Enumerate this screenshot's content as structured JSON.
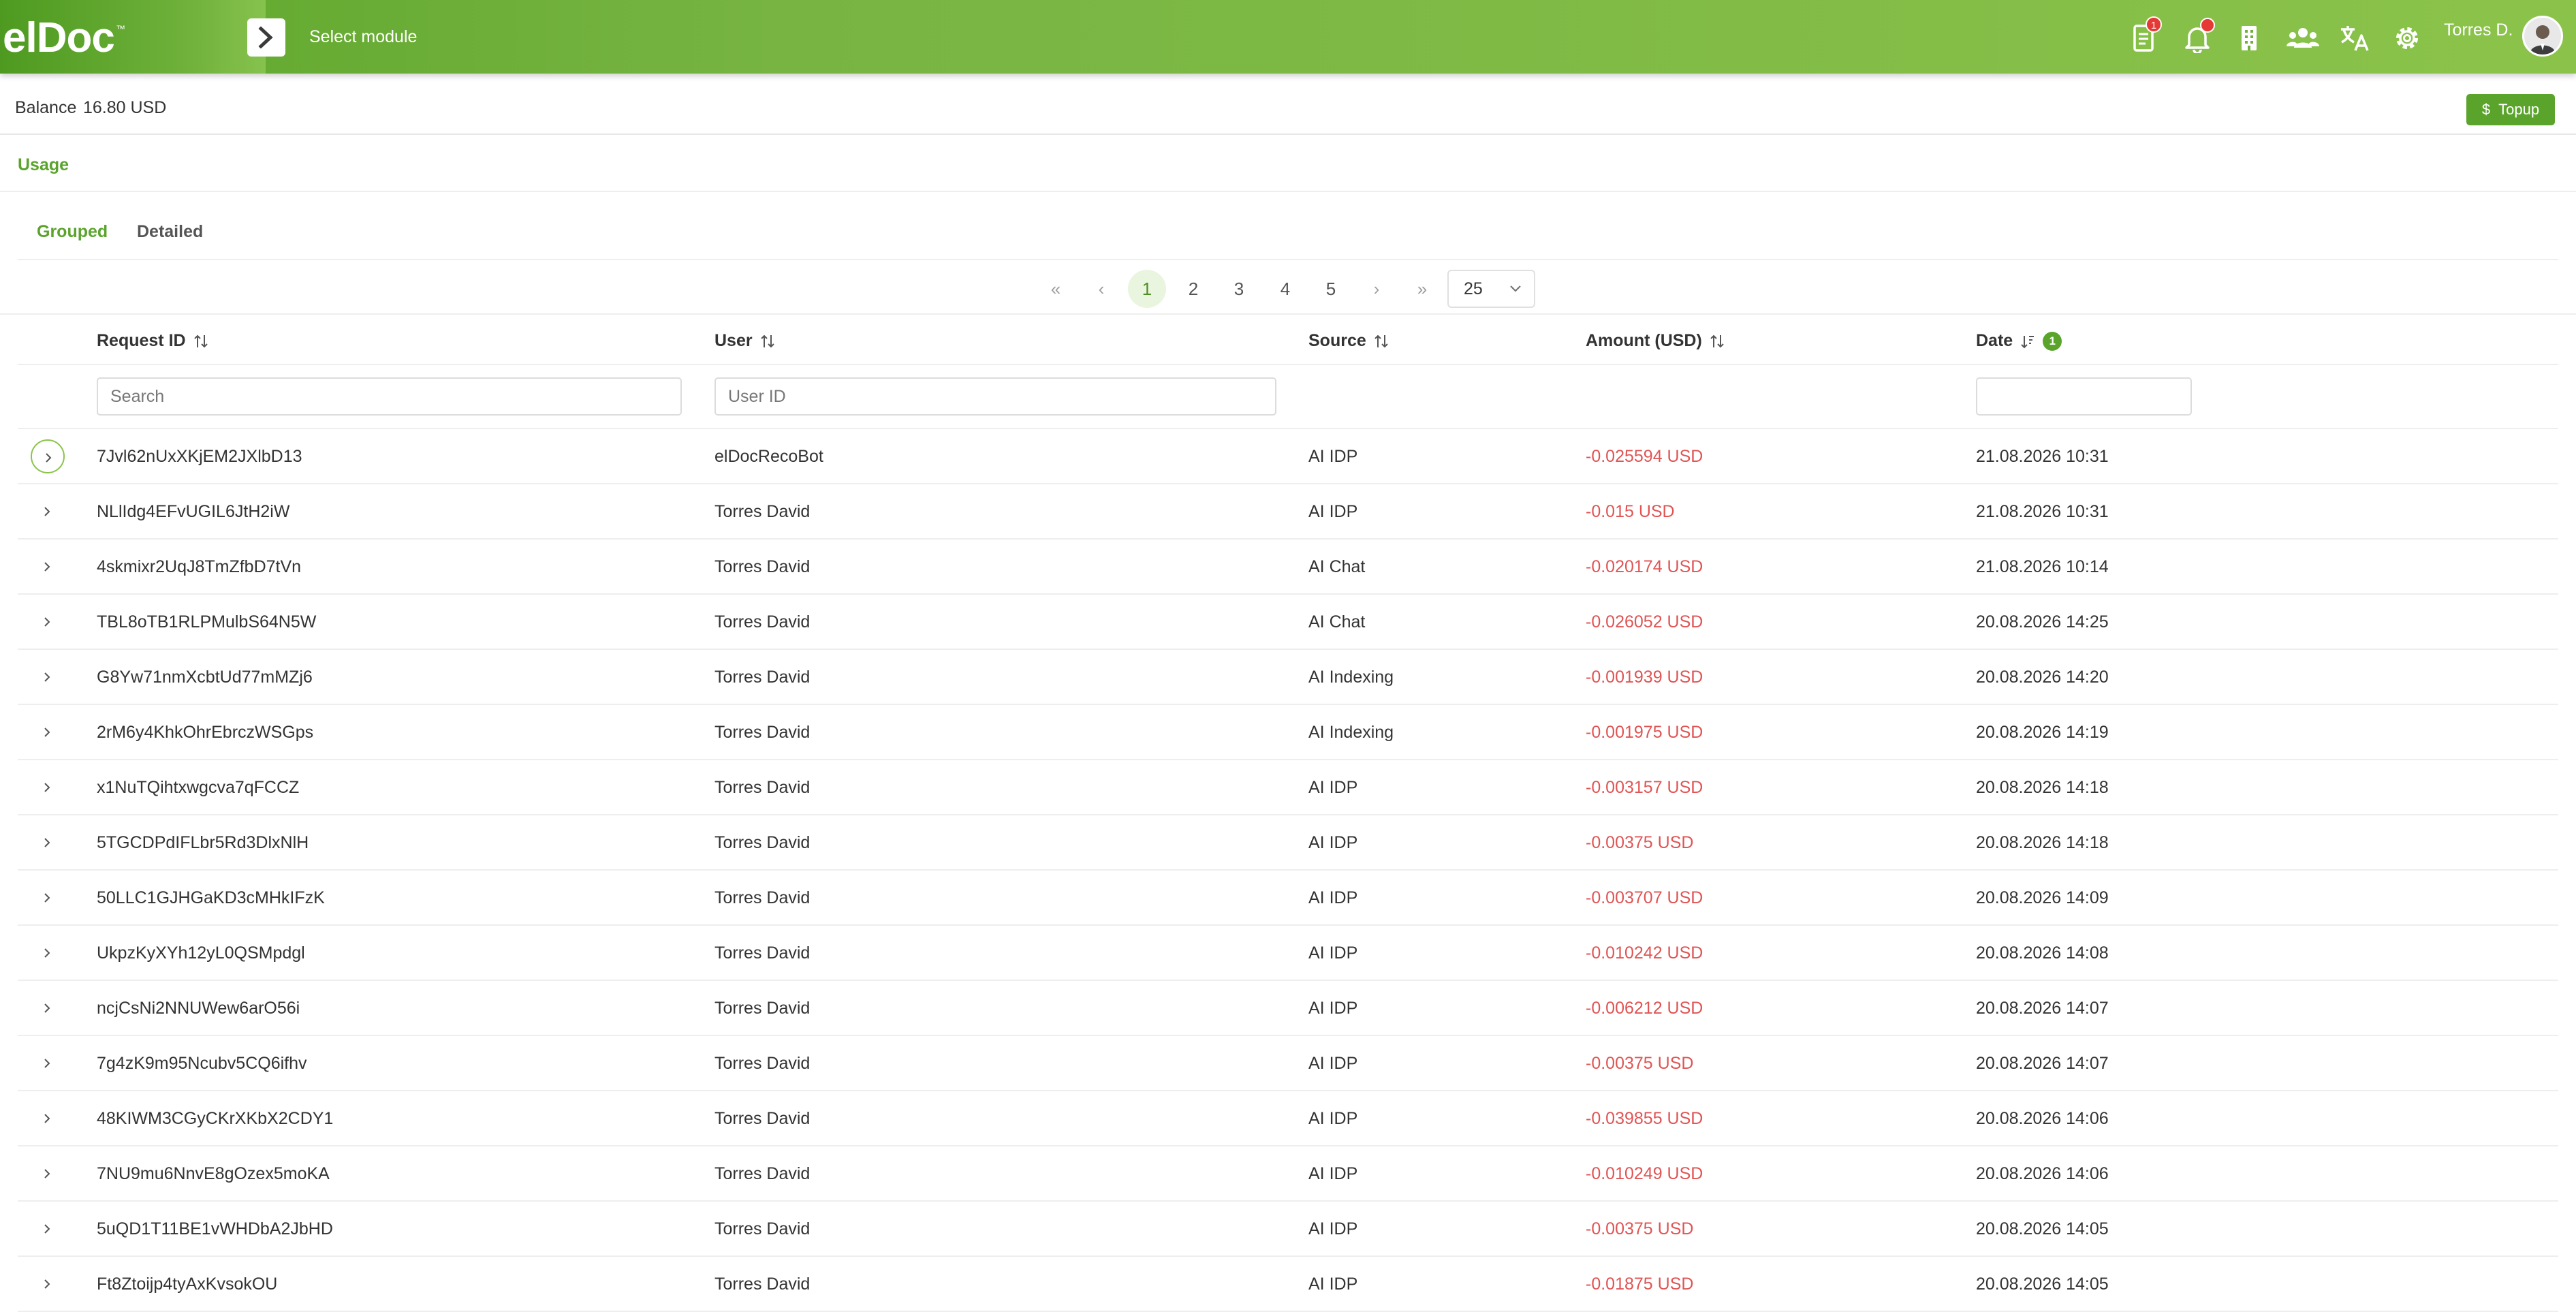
{
  "header": {
    "logo": "elDoc",
    "logo_tm": "™",
    "module_label": "Select module",
    "documents_badge": "1",
    "user_name": "Torres D."
  },
  "balance": {
    "label": "Balance",
    "value": "16.80 USD",
    "topup_label": "Topup"
  },
  "usage": {
    "title": "Usage"
  },
  "tabs": [
    {
      "label": "Grouped",
      "active": true
    },
    {
      "label": "Detailed",
      "active": false
    }
  ],
  "pagination": {
    "first": "«",
    "prev": "‹",
    "pages": [
      "1",
      "2",
      "3",
      "4",
      "5"
    ],
    "active_page": "1",
    "next": "›",
    "last": "»",
    "rows_per_page": "25"
  },
  "table": {
    "columns": {
      "request_id": "Request ID",
      "user": "User",
      "source": "Source",
      "amount": "Amount (USD)",
      "date": "Date",
      "date_sort_badge": "1"
    },
    "filters": {
      "request_id_placeholder": "Search",
      "user_placeholder": "User ID",
      "date_placeholder": ""
    },
    "rows": [
      {
        "request_id": "7Jvl62nUxXKjEM2JXlbD13",
        "user": "elDocRecoBot",
        "source": "AI IDP",
        "amount": "-0.025594 USD",
        "date": "21.08.2026 10:31"
      },
      {
        "request_id": "NLlIdg4EFvUGIL6JtH2iW",
        "user": "Torres David",
        "source": "AI IDP",
        "amount": "-0.015 USD",
        "date": "21.08.2026 10:31"
      },
      {
        "request_id": "4skmixr2UqJ8TmZfbD7tVn",
        "user": "Torres David",
        "source": "AI Chat",
        "amount": "-0.020174 USD",
        "date": "21.08.2026 10:14"
      },
      {
        "request_id": "TBL8oTB1RLPMulbS64N5W",
        "user": "Torres David",
        "source": "AI Chat",
        "amount": "-0.026052 USD",
        "date": "20.08.2026 14:25"
      },
      {
        "request_id": "G8Yw71nmXcbtUd77mMZj6",
        "user": "Torres David",
        "source": "AI Indexing",
        "amount": "-0.001939 USD",
        "date": "20.08.2026 14:20"
      },
      {
        "request_id": "2rM6y4KhkOhrEbrczWSGps",
        "user": "Torres David",
        "source": "AI Indexing",
        "amount": "-0.001975 USD",
        "date": "20.08.2026 14:19"
      },
      {
        "request_id": "x1NuTQihtxwgcva7qFCCZ",
        "user": "Torres David",
        "source": "AI IDP",
        "amount": "-0.003157 USD",
        "date": "20.08.2026 14:18"
      },
      {
        "request_id": "5TGCDPdIFLbr5Rd3DlxNlH",
        "user": "Torres David",
        "source": "AI IDP",
        "amount": "-0.00375 USD",
        "date": "20.08.2026 14:18"
      },
      {
        "request_id": "50LLC1GJHGaKD3cMHkIFzK",
        "user": "Torres David",
        "source": "AI IDP",
        "amount": "-0.003707 USD",
        "date": "20.08.2026 14:09"
      },
      {
        "request_id": "UkpzKyXYh12yL0QSMpdgl",
        "user": "Torres David",
        "source": "AI IDP",
        "amount": "-0.010242 USD",
        "date": "20.08.2026 14:08"
      },
      {
        "request_id": "ncjCsNi2NNUWew6arO56i",
        "user": "Torres David",
        "source": "AI IDP",
        "amount": "-0.006212 USD",
        "date": "20.08.2026 14:07"
      },
      {
        "request_id": "7g4zK9m95Ncubv5CQ6ifhv",
        "user": "Torres David",
        "source": "AI IDP",
        "amount": "-0.00375 USD",
        "date": "20.08.2026 14:07"
      },
      {
        "request_id": "48KIWM3CGyCKrXKbX2CDY1",
        "user": "Torres David",
        "source": "AI IDP",
        "amount": "-0.039855 USD",
        "date": "20.08.2026 14:06"
      },
      {
        "request_id": "7NU9mu6NnvE8gOzex5moKA",
        "user": "Torres David",
        "source": "AI IDP",
        "amount": "-0.010249 USD",
        "date": "20.08.2026 14:06"
      },
      {
        "request_id": "5uQD1T11BE1vWHDbA2JbHD",
        "user": "Torres David",
        "source": "AI IDP",
        "amount": "-0.00375 USD",
        "date": "20.08.2026 14:05"
      },
      {
        "request_id": "Ft8Ztoijp4tyAxKvsokOU",
        "user": "Torres David",
        "source": "AI IDP",
        "amount": "-0.01875 USD",
        "date": "20.08.2026 14:05"
      }
    ]
  },
  "colors": {
    "brand_green": "#5aa42c",
    "amount_red": "#e05454"
  },
  "icons": {
    "module": "chevron-right-icon",
    "documents": "document-icon",
    "notifications": "bell-icon",
    "organization": "building-icon",
    "users": "users-icon",
    "language": "translate-icon",
    "settings": "gear-icon",
    "topup": "dollar-icon",
    "sort": "sort-icon",
    "expand": "chevron-right-icon"
  }
}
